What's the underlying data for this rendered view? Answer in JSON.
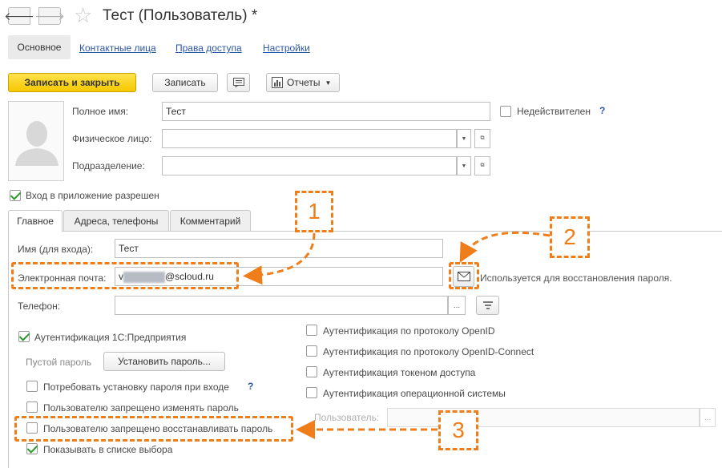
{
  "window": {
    "title": "Тест (Пользователь) *"
  },
  "nav": {
    "back": "🡐",
    "forward": "🡒",
    "star": "☆"
  },
  "tabs_top": [
    "Основное",
    "Контактные лица",
    "Права доступа",
    "Настройки"
  ],
  "toolbar": {
    "save_close": "Записать и закрыть",
    "save": "Записать",
    "reports": "Отчеты"
  },
  "form": {
    "full_name_label": "Полное имя:",
    "full_name": "Тест",
    "person_label": "Физическое лицо:",
    "person": "",
    "department_label": "Подразделение:",
    "department": "",
    "invalid_label": "Недействителен",
    "login_allowed_label": "Вход в приложение разрешен"
  },
  "inner_tabs": [
    "Главное",
    "Адреса, телефоны",
    "Комментарий"
  ],
  "main": {
    "login_label": "Имя (для входа):",
    "login": "Тест",
    "email_label": "Электронная почта:",
    "email_prefix": "v",
    "email_suffix": "@scloud.ru",
    "email_hint": "Используется для восстановления пароля.",
    "phone_label": "Телефон:",
    "phone": "",
    "auth_1c": "Аутентификация 1С:Предприятия",
    "empty_password": "Пустой пароль",
    "set_password": "Установить пароль...",
    "require_password": "Потребовать установку пароля при входе",
    "forbid_change": "Пользователю запрещено изменять пароль",
    "forbid_restore": "Пользователю запрещено восстанавливать пароль",
    "show_in_list": "Показывать в списке выбора",
    "auth_openid": "Аутентификация по протоколу OpenID",
    "auth_openid_connect": "Аутентификация по протоколу OpenID-Connect",
    "auth_token": "Аутентификация токеном доступа",
    "auth_os": "Аутентификация операционной системы",
    "user_label": "Пользователь:",
    "user_value": ""
  },
  "annotations": {
    "n1": "1",
    "n2": "2",
    "n3": "3"
  },
  "colors": {
    "accent": "#ef7d1a",
    "link": "#2a56a8",
    "primary_button": "#f5c800"
  }
}
